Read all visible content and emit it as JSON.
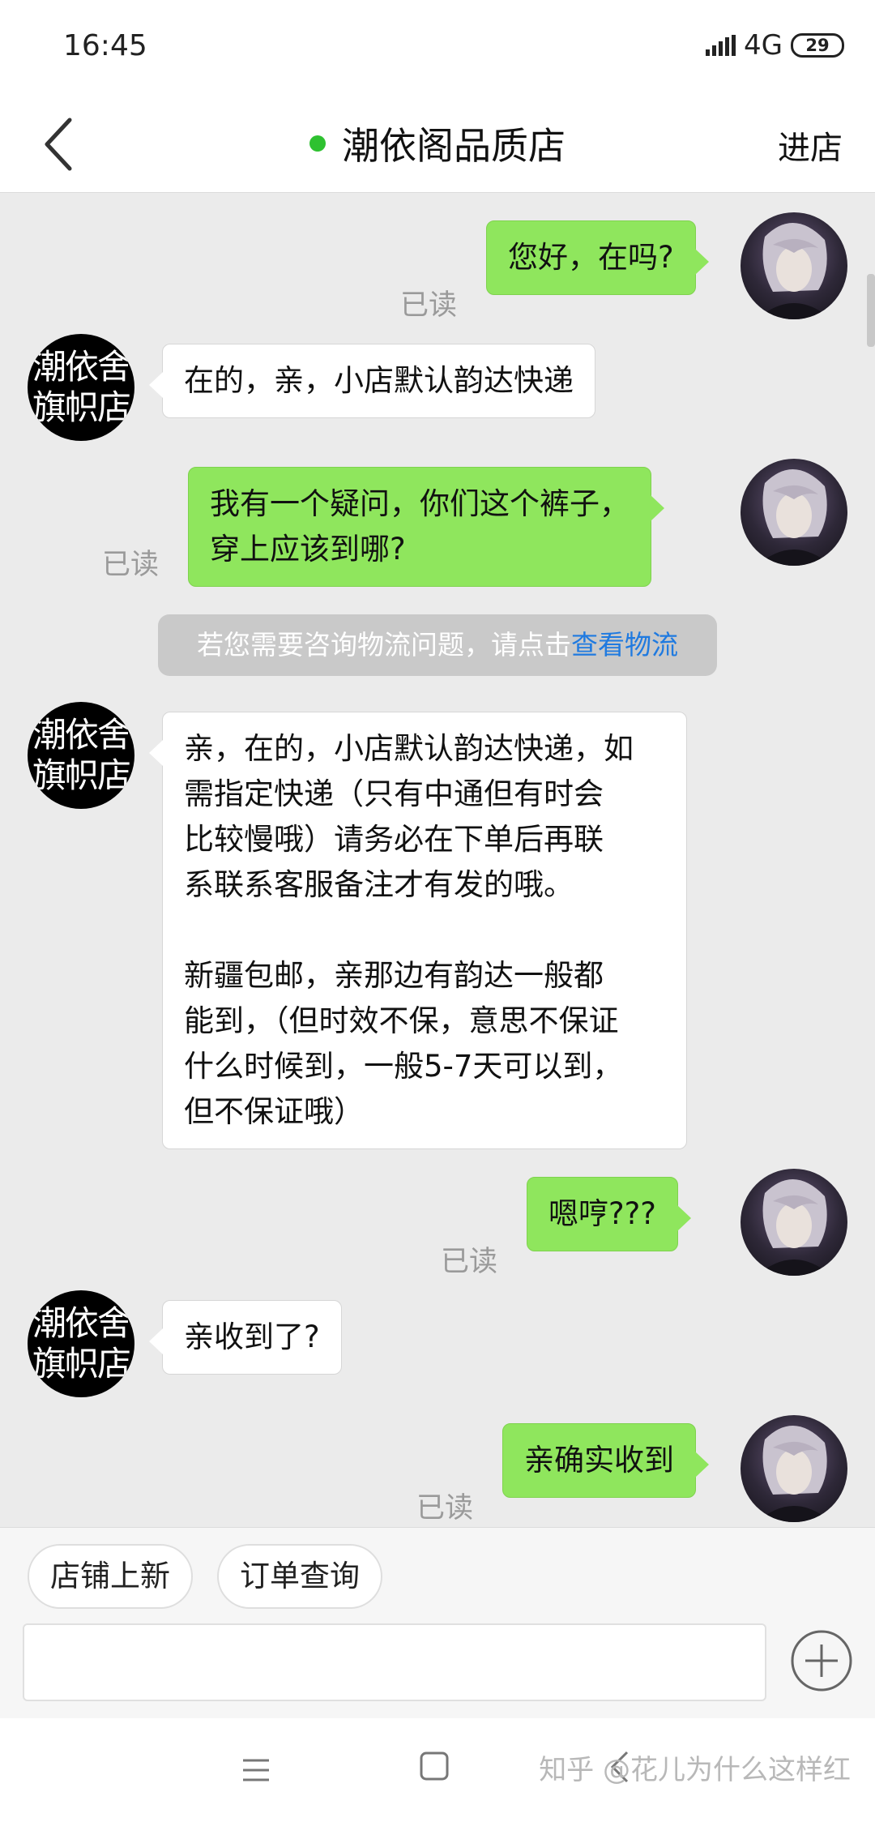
{
  "status_bar": {
    "time": "16:45",
    "network": "4G",
    "battery": "29"
  },
  "header": {
    "title": "潮依阁品质店",
    "enter_shop": "进店",
    "online_color": "#2ec130"
  },
  "shop_avatar": {
    "line1": "潮依舍",
    "line2": "旗帜店"
  },
  "messages": [
    {
      "from": "me",
      "text": "您好，在吗?",
      "status": "已读"
    },
    {
      "from": "shop",
      "text": "在的，亲，小店默认韵达快递"
    },
    {
      "from": "me",
      "lines": [
        "我有一个疑问，你们这个裤子，",
        "穿上应该到哪?"
      ],
      "status": "已读"
    },
    {
      "from": "shop",
      "paragraph1": [
        "亲，在的，小店默认韵达快递，如",
        "需指定快递（只有中通但有时会",
        "比较慢哦）请务必在下单后再联",
        "系联系客服备注才有发的哦。"
      ],
      "paragraph2": [
        "新疆包邮，亲那边有韵达一般都",
        "能到，（但时效不保，意思不保证",
        "什么时候到，一般5-7天可以到，",
        "但不保证哦）"
      ]
    },
    {
      "from": "me",
      "text": "嗯哼???",
      "status": "已读"
    },
    {
      "from": "shop",
      "text": "亲收到了?"
    },
    {
      "from": "me",
      "text": "亲确实收到",
      "status": "已读"
    }
  ],
  "notice": {
    "text": "若您需要咨询物流问题，请点击",
    "link": "查看物流"
  },
  "quick_actions": [
    "店铺上新",
    "订单查询"
  ],
  "input": {
    "value": "",
    "placeholder": ""
  },
  "watermark": "知乎 @花儿为什么这样红",
  "colors": {
    "my_bubble": "#8fe65d",
    "link": "#1f7ae0"
  }
}
